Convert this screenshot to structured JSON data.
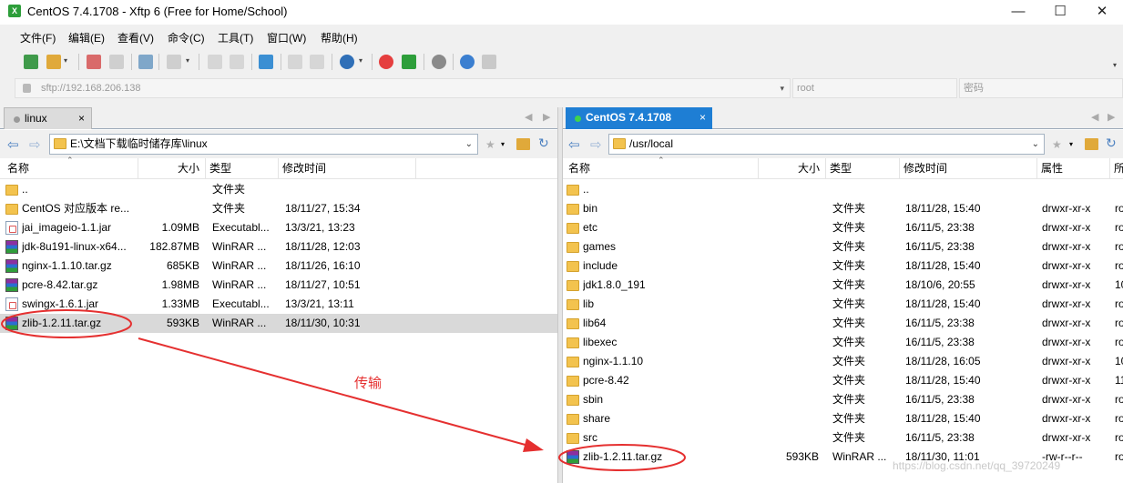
{
  "window": {
    "title": "CentOS 7.4.1708 - Xftp 6 (Free for Home/School)",
    "minimize": "—",
    "maximize": "☐",
    "close": "✕"
  },
  "menu": [
    "文件(F)",
    "编辑(E)",
    "查看(V)",
    "命令(C)",
    "工具(T)",
    "窗口(W)",
    "帮助(H)"
  ],
  "address": {
    "host": "sftp://192.168.206.138",
    "user_placeholder": "root",
    "password_placeholder": "密码"
  },
  "left_pane": {
    "tab": {
      "label": "linux",
      "close": "×"
    },
    "path": "E:\\文档下载临时储存库\\linux",
    "columns": [
      "名称",
      "大小",
      "类型",
      "修改时间"
    ],
    "rows": [
      {
        "icon": "folder-icon",
        "name": "..",
        "size": "",
        "type": "文件夹",
        "modified": ""
      },
      {
        "icon": "folder-icon",
        "name": "CentOS 对应版本 re...",
        "size": "",
        "type": "文件夹",
        "modified": "18/11/27, 15:34"
      },
      {
        "icon": "jar-file-icon",
        "name": "jai_imageio-1.1.jar",
        "size": "1.09MB",
        "type": "Executabl...",
        "modified": "13/3/21, 13:23"
      },
      {
        "icon": "rar-archive-icon",
        "name": "jdk-8u191-linux-x64...",
        "size": "182.87MB",
        "type": "WinRAR ...",
        "modified": "18/11/28, 12:03"
      },
      {
        "icon": "rar-archive-icon",
        "name": "nginx-1.1.10.tar.gz",
        "size": "685KB",
        "type": "WinRAR ...",
        "modified": "18/11/26, 16:10"
      },
      {
        "icon": "rar-archive-icon",
        "name": "pcre-8.42.tar.gz",
        "size": "1.98MB",
        "type": "WinRAR ...",
        "modified": "18/11/27, 10:51"
      },
      {
        "icon": "jar-file-icon",
        "name": "swingx-1.6.1.jar",
        "size": "1.33MB",
        "type": "Executabl...",
        "modified": "13/3/21, 13:11"
      },
      {
        "icon": "rar-archive-icon",
        "name": "zlib-1.2.11.tar.gz",
        "size": "593KB",
        "type": "WinRAR ...",
        "modified": "18/11/30, 10:31",
        "selected": true
      }
    ]
  },
  "right_pane": {
    "tab": {
      "label": "CentOS 7.4.1708",
      "close": "×"
    },
    "path": "/usr/local",
    "columns": [
      "名称",
      "大小",
      "类型",
      "修改时间",
      "属性",
      "所"
    ],
    "rows": [
      {
        "icon": "folder-icon",
        "name": "..",
        "size": "",
        "type": "",
        "modified": "",
        "attr": "",
        "owner": ""
      },
      {
        "icon": "folder-icon",
        "name": "bin",
        "size": "",
        "type": "文件夹",
        "modified": "18/11/28, 15:40",
        "attr": "drwxr-xr-x",
        "owner": "ro"
      },
      {
        "icon": "folder-icon",
        "name": "etc",
        "size": "",
        "type": "文件夹",
        "modified": "16/11/5, 23:38",
        "attr": "drwxr-xr-x",
        "owner": "ro"
      },
      {
        "icon": "folder-icon",
        "name": "games",
        "size": "",
        "type": "文件夹",
        "modified": "16/11/5, 23:38",
        "attr": "drwxr-xr-x",
        "owner": "ro"
      },
      {
        "icon": "folder-icon",
        "name": "include",
        "size": "",
        "type": "文件夹",
        "modified": "18/11/28, 15:40",
        "attr": "drwxr-xr-x",
        "owner": "ro"
      },
      {
        "icon": "folder-icon",
        "name": "jdk1.8.0_191",
        "size": "",
        "type": "文件夹",
        "modified": "18/10/6, 20:55",
        "attr": "drwxr-xr-x",
        "owner": "10"
      },
      {
        "icon": "folder-icon",
        "name": "lib",
        "size": "",
        "type": "文件夹",
        "modified": "18/11/28, 15:40",
        "attr": "drwxr-xr-x",
        "owner": "ro"
      },
      {
        "icon": "folder-icon",
        "name": "lib64",
        "size": "",
        "type": "文件夹",
        "modified": "16/11/5, 23:38",
        "attr": "drwxr-xr-x",
        "owner": "ro"
      },
      {
        "icon": "folder-icon",
        "name": "libexec",
        "size": "",
        "type": "文件夹",
        "modified": "16/11/5, 23:38",
        "attr": "drwxr-xr-x",
        "owner": "ro"
      },
      {
        "icon": "folder-icon",
        "name": "nginx-1.1.10",
        "size": "",
        "type": "文件夹",
        "modified": "18/11/28, 16:05",
        "attr": "drwxr-xr-x",
        "owner": "10"
      },
      {
        "icon": "folder-icon",
        "name": "pcre-8.42",
        "size": "",
        "type": "文件夹",
        "modified": "18/11/28, 15:40",
        "attr": "drwxr-xr-x",
        "owner": "11"
      },
      {
        "icon": "folder-icon",
        "name": "sbin",
        "size": "",
        "type": "文件夹",
        "modified": "16/11/5, 23:38",
        "attr": "drwxr-xr-x",
        "owner": "ro"
      },
      {
        "icon": "folder-icon",
        "name": "share",
        "size": "",
        "type": "文件夹",
        "modified": "18/11/28, 15:40",
        "attr": "drwxr-xr-x",
        "owner": "ro"
      },
      {
        "icon": "folder-icon",
        "name": "src",
        "size": "",
        "type": "文件夹",
        "modified": "16/11/5, 23:38",
        "attr": "drwxr-xr-x",
        "owner": "ro"
      },
      {
        "icon": "rar-archive-icon",
        "name": "zlib-1.2.11.tar.gz",
        "size": "593KB",
        "type": "WinRAR ...",
        "modified": "18/11/30, 11:01",
        "attr": "-rw-r--r--",
        "owner": "ro"
      }
    ]
  },
  "annotation": {
    "label": "传输",
    "color": "#e53030"
  },
  "watermark": "https://blog.csdn.net/qq_39720249"
}
